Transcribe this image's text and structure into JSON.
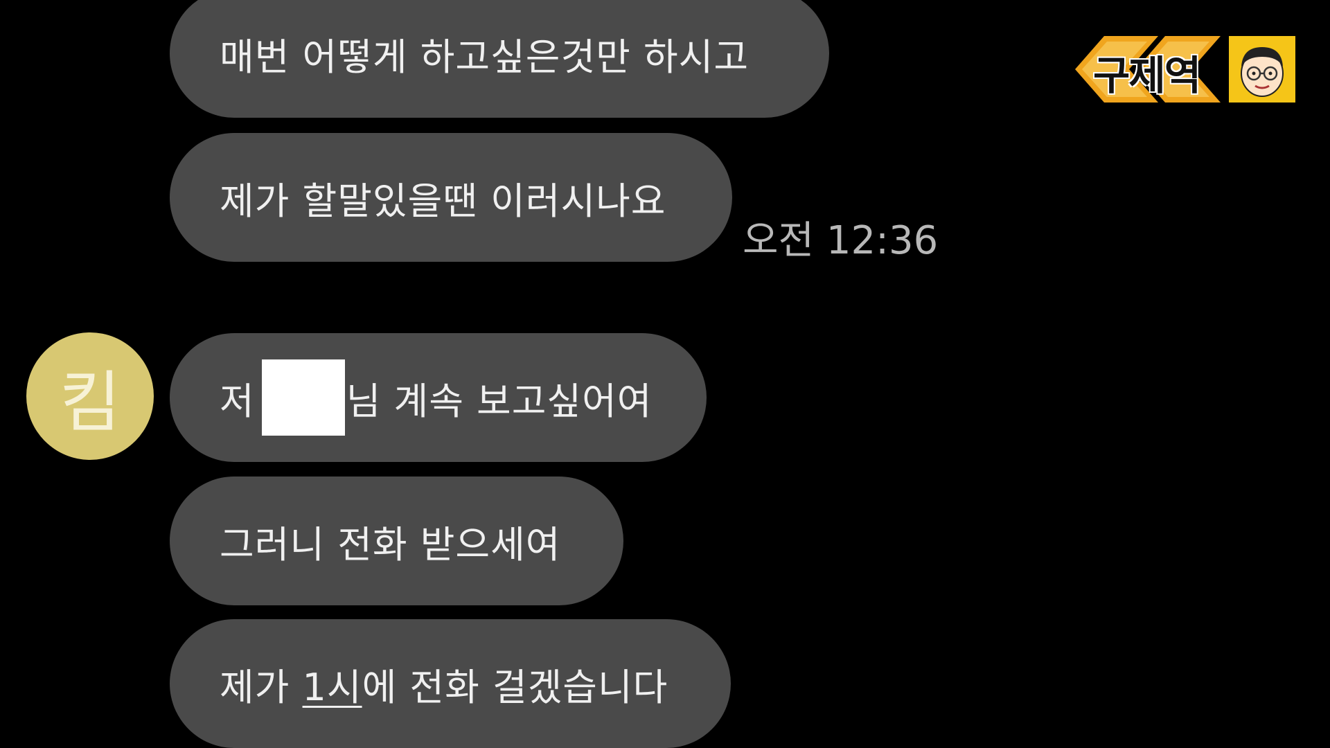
{
  "messages": [
    {
      "text": "매번 어떻게 하고싶은것만 하시고"
    },
    {
      "text": "제가 할말있을땐 이러시나요"
    },
    {
      "prefix": "저",
      "suffix": "님 계속 보고싶어여"
    },
    {
      "text": "그러니 전화 받으세여"
    },
    {
      "prefix": "제가 ",
      "link": "1시",
      "suffix": "에 전화 걸겠습니다"
    }
  ],
  "timestamp": "오전 12:36",
  "avatar": {
    "initial": "킴",
    "color": "#d8c872"
  },
  "logo": {
    "text": "구제역",
    "accent": "#f0a51e",
    "face_bg": "#f5c518"
  },
  "colors": {
    "background": "#000000",
    "bubble": "#4a4a4a",
    "text": "#f0f0f0",
    "timestamp": "#b8b8b8"
  }
}
